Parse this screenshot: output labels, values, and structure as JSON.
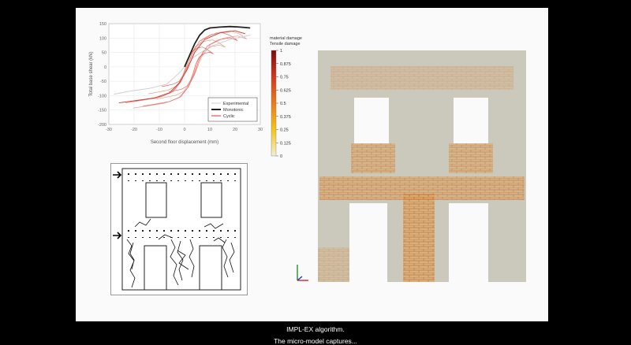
{
  "chart_data": {
    "type": "line",
    "xlabel": "Second floor displacement (mm)",
    "ylabel": "Total base shear (kN)",
    "xlim": [
      -30,
      30
    ],
    "ylim": [
      -200,
      150
    ],
    "xticks": [
      -30,
      -20,
      -10,
      0,
      10,
      20,
      30
    ],
    "yticks": [
      150,
      100,
      50,
      0,
      -50,
      -100,
      -150,
      -200
    ],
    "grid": true,
    "legend_position": "bottom-right",
    "series": [
      {
        "name": "Experimental",
        "color": "#cfcfcf",
        "x": [
          -28,
          -22,
          -14,
          -7,
          -2,
          3,
          10,
          18,
          26
        ],
        "y": [
          -95,
          -85,
          -75,
          -60,
          -20,
          30,
          70,
          95,
          110
        ]
      },
      {
        "name": "Monotonic",
        "color": "#222222",
        "x": [
          0,
          2,
          4,
          6,
          8,
          10,
          14,
          18,
          22,
          26
        ],
        "y": [
          0,
          40,
          80,
          110,
          128,
          135,
          138,
          140,
          138,
          135
        ]
      },
      {
        "name": "Cyclic",
        "color": "#d9382a",
        "x": [
          -26,
          -20,
          -12,
          -6,
          -2,
          1,
          4,
          8,
          14,
          20,
          24
        ],
        "y": [
          -125,
          -118,
          -108,
          -90,
          -55,
          -10,
          50,
          95,
          118,
          125,
          115
        ]
      }
    ]
  },
  "colorbar": {
    "title_line1": "material damage",
    "title_line2": "Tensile damage",
    "ticks": [
      "1",
      "0.875",
      "0.75",
      "0.625",
      "0.5",
      "0.375",
      "0.25",
      "0.125",
      "0"
    ],
    "colors": [
      "#7a0c0c",
      "#b21e1e",
      "#d2351f",
      "#e1561c",
      "#ea7c1a",
      "#f0a41a",
      "#f4c419",
      "#f7de4a",
      "#f3efd4"
    ]
  },
  "subtitles": {
    "line1": "IMPL-EX algorithm.",
    "line2": "The micro-model captures..."
  }
}
